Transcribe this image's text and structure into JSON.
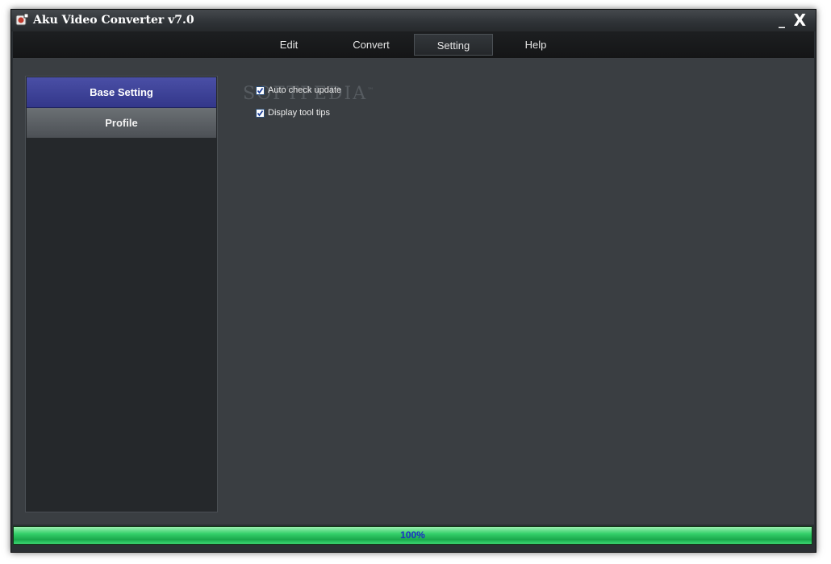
{
  "window": {
    "title": "Aku Video Converter v7.0",
    "minimize_label": "_",
    "close_label": "X"
  },
  "menu": {
    "items": [
      {
        "label": "Edit"
      },
      {
        "label": "Convert"
      },
      {
        "label": "Setting",
        "active": true
      },
      {
        "label": "Help"
      }
    ]
  },
  "sidebar": {
    "items": [
      {
        "label": "Base Setting",
        "selected": true
      },
      {
        "label": "Profile",
        "selected": false
      }
    ]
  },
  "settings": {
    "auto_check_update": {
      "label": "Auto check update",
      "checked": true
    },
    "display_tool_tips": {
      "label": "Display tool tips",
      "checked": true
    }
  },
  "watermark": {
    "text": "SOFTPEDIA",
    "mark": "™"
  },
  "progress": {
    "value": 1.0,
    "label": "100%"
  },
  "colors": {
    "accent": "#33378a",
    "progress_green": "#34d06a",
    "progress_text": "#1d2cc7"
  }
}
